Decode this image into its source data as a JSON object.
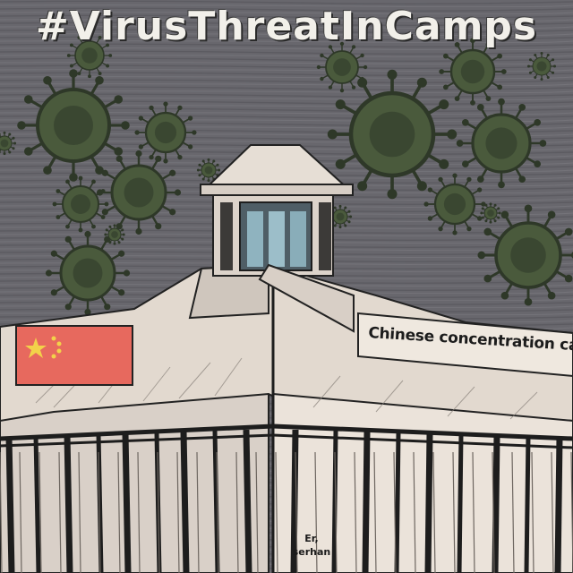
{
  "title": "#VirusThreatInCamps",
  "banner": "Chinese concentration camps",
  "signature": {
    "line1": "Er,",
    "line2": "serhan"
  },
  "colors": {
    "sky": "#67666c",
    "virus": "#4a5a3c",
    "virus_dark": "#2e3828",
    "building": "#e3dbd2",
    "flag_red": "#e7695e",
    "flag_star": "#f2d24a"
  },
  "icons": [
    "virus-icon",
    "china-flag-icon",
    "watchtower-icon"
  ]
}
